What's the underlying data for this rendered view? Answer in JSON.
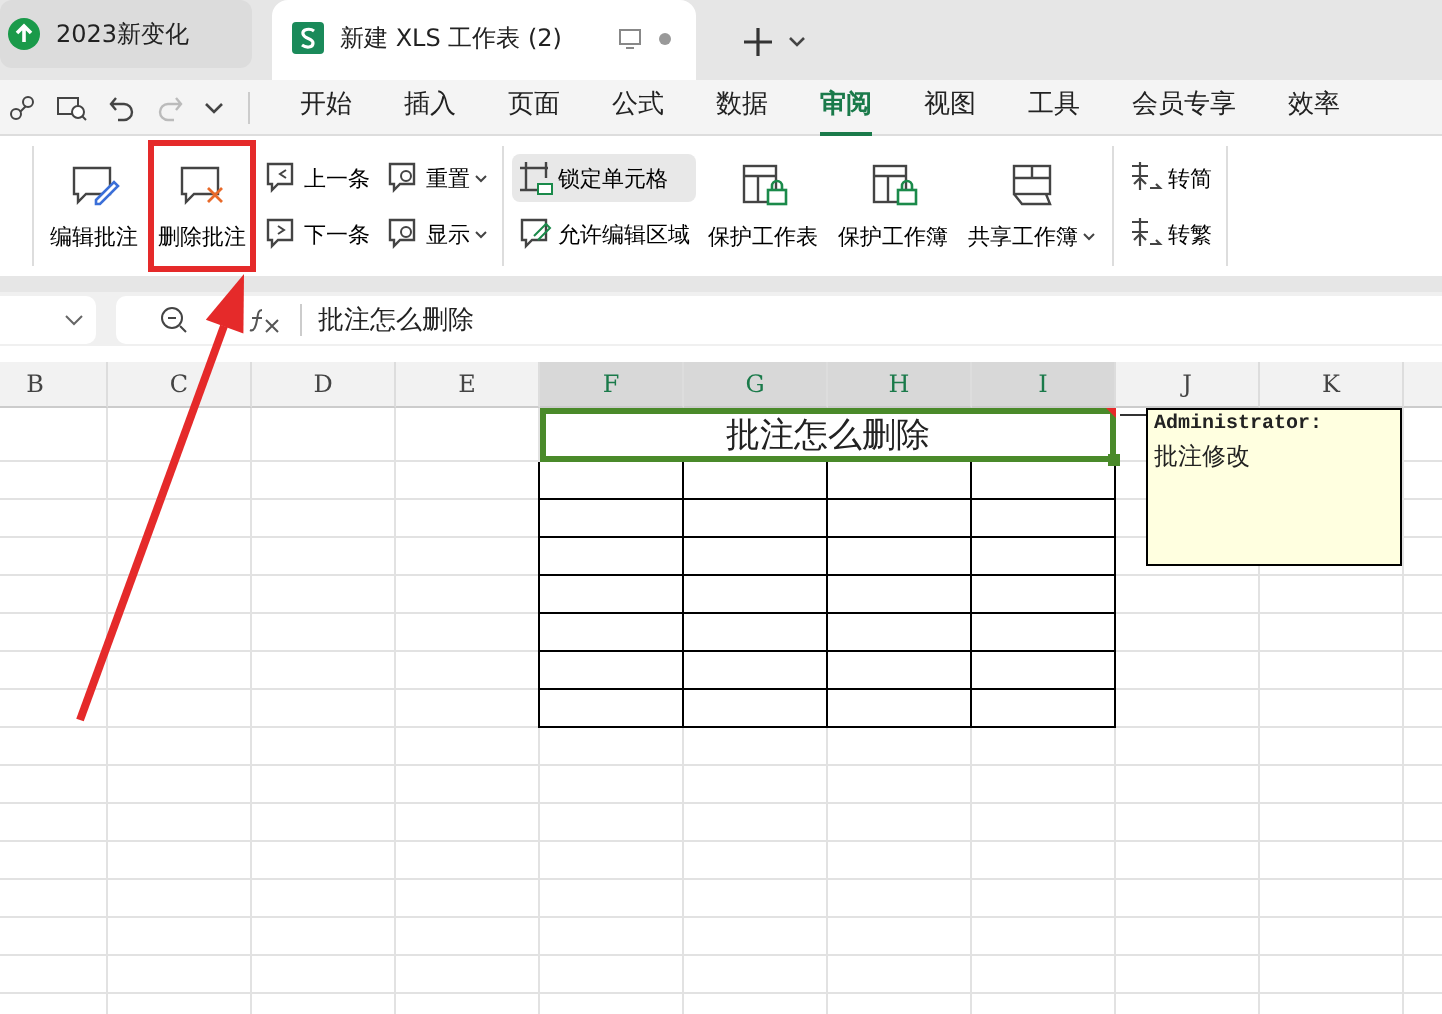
{
  "app_tabs": [
    {
      "title": "2023新变化",
      "selected": false
    },
    {
      "title": "新建 XLS 工作表 (2)",
      "selected": true
    }
  ],
  "menu_tabs": [
    {
      "label": "开始",
      "selected": false
    },
    {
      "label": "插入",
      "selected": false
    },
    {
      "label": "页面",
      "selected": false
    },
    {
      "label": "公式",
      "selected": false
    },
    {
      "label": "数据",
      "selected": false
    },
    {
      "label": "审阅",
      "selected": true
    },
    {
      "label": "视图",
      "selected": false
    },
    {
      "label": "工具",
      "selected": false
    },
    {
      "label": "会员专享",
      "selected": false
    },
    {
      "label": "效率",
      "selected": false
    }
  ],
  "ribbon_groups": [
    {
      "items": [
        {
          "kind": "large",
          "label": "编辑批注",
          "annotated": false
        },
        {
          "kind": "large",
          "label": "删除批注",
          "annotated": true
        },
        {
          "kind": "stack",
          "items": [
            {
              "label": "上一条",
              "dropdown": false,
              "pressed": false
            },
            {
              "label": "下一条",
              "dropdown": false,
              "pressed": false
            }
          ]
        },
        {
          "kind": "stack",
          "items": [
            {
              "label": "重置",
              "dropdown": true,
              "pressed": false
            },
            {
              "label": "显示",
              "dropdown": true,
              "pressed": false
            }
          ]
        }
      ]
    },
    {
      "items": [
        {
          "kind": "stack",
          "items": [
            {
              "label": "锁定单元格",
              "dropdown": false,
              "pressed": true
            },
            {
              "label": "允许编辑区域",
              "dropdown": false,
              "pressed": false
            }
          ]
        },
        {
          "kind": "large",
          "label": "保护工作表",
          "annotated": false,
          "dropdown": false
        },
        {
          "kind": "large",
          "label": "保护工作簿",
          "annotated": false,
          "dropdown": false
        },
        {
          "kind": "large",
          "label": "共享工作簿",
          "annotated": false,
          "dropdown": true
        }
      ]
    },
    {
      "items": [
        {
          "kind": "stack",
          "items": [
            {
              "label": "转简",
              "dropdown": false,
              "pressed": false
            },
            {
              "label": "转繁",
              "dropdown": false,
              "pressed": false
            }
          ]
        }
      ]
    }
  ],
  "formula_bar": {
    "formula": "批注怎么删除"
  },
  "columns": [
    {
      "name": "B",
      "selected": false
    },
    {
      "name": "C",
      "selected": false
    },
    {
      "name": "D",
      "selected": false
    },
    {
      "name": "E",
      "selected": false
    },
    {
      "name": "F",
      "selected": true
    },
    {
      "name": "G",
      "selected": true
    },
    {
      "name": "H",
      "selected": true
    },
    {
      "name": "I",
      "selected": true
    },
    {
      "name": "J",
      "selected": false
    },
    {
      "name": "K",
      "selected": false
    }
  ],
  "merged_title": "批注怎么删除",
  "comment": {
    "author": "Administrator:",
    "text": "批注修改"
  }
}
